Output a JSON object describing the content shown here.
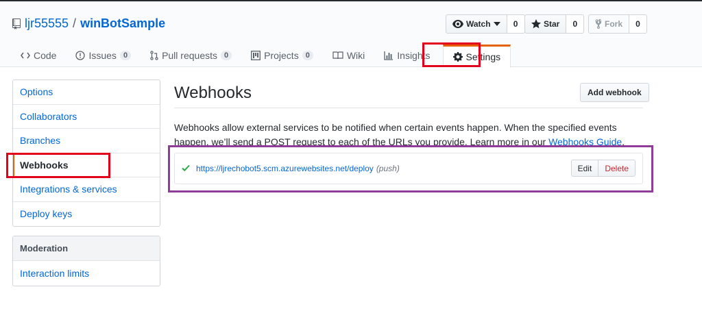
{
  "repo": {
    "owner": "ljr55555",
    "separator": "/",
    "name": "winBotSample"
  },
  "actions": {
    "watch": {
      "label": "Watch",
      "count": "0"
    },
    "star": {
      "label": "Star",
      "count": "0"
    },
    "fork": {
      "label": "Fork",
      "count": "0"
    }
  },
  "tabs": [
    {
      "label": "Code",
      "icon": "code-icon"
    },
    {
      "label": "Issues",
      "count": "0",
      "icon": "issue-icon"
    },
    {
      "label": "Pull requests",
      "count": "0",
      "icon": "pull-request-icon"
    },
    {
      "label": "Projects",
      "count": "0",
      "icon": "project-icon"
    },
    {
      "label": "Wiki",
      "icon": "book-icon"
    },
    {
      "label": "Insights",
      "icon": "graph-icon"
    },
    {
      "label": "Settings",
      "icon": "gear-icon",
      "selected": true
    }
  ],
  "menu": {
    "items": [
      {
        "label": "Options"
      },
      {
        "label": "Collaborators"
      },
      {
        "label": "Branches"
      },
      {
        "label": "Webhooks",
        "selected": true
      },
      {
        "label": "Integrations & services"
      },
      {
        "label": "Deploy keys"
      }
    ],
    "moderation": {
      "heading": "Moderation",
      "items": [
        {
          "label": "Interaction limits"
        }
      ]
    }
  },
  "content": {
    "title": "Webhooks",
    "add_button": "Add webhook",
    "description": "Webhooks allow external services to be notified when certain events happen. When the specified events happen, we’ll send a POST request to each of the URLs you provide. Learn more in our ",
    "guide_link": "Webhooks Guide",
    "description_end": ".",
    "hook": {
      "url": "https://ljrechobot5.scm.azurewebsites.net/deploy",
      "events": "(push)",
      "edit_label": "Edit",
      "delete_label": "Delete"
    }
  },
  "colors": {
    "accent_orange": "#e36209",
    "link_blue": "#0366d6",
    "success_green": "#28a745",
    "annotation_red": "#e3001b",
    "annotation_purple": "#8f3d99"
  }
}
